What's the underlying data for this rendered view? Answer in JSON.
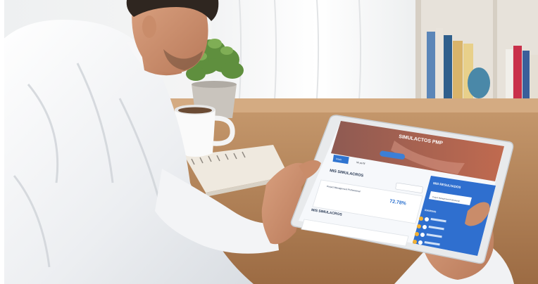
{
  "tablet_screen": {
    "banner_title": "SIMULACTOS PMP",
    "tab_active": "Inicio",
    "tab_other": "Mi perfil",
    "panel_left_title": "MIS SIMULACROS",
    "card_label": "Project Management Professional",
    "score_value": "72.78%",
    "panel_right_title": "MIS RESULTADOS",
    "panel_right_button": "Project Management Professional",
    "ranking_title": "RANKING"
  }
}
